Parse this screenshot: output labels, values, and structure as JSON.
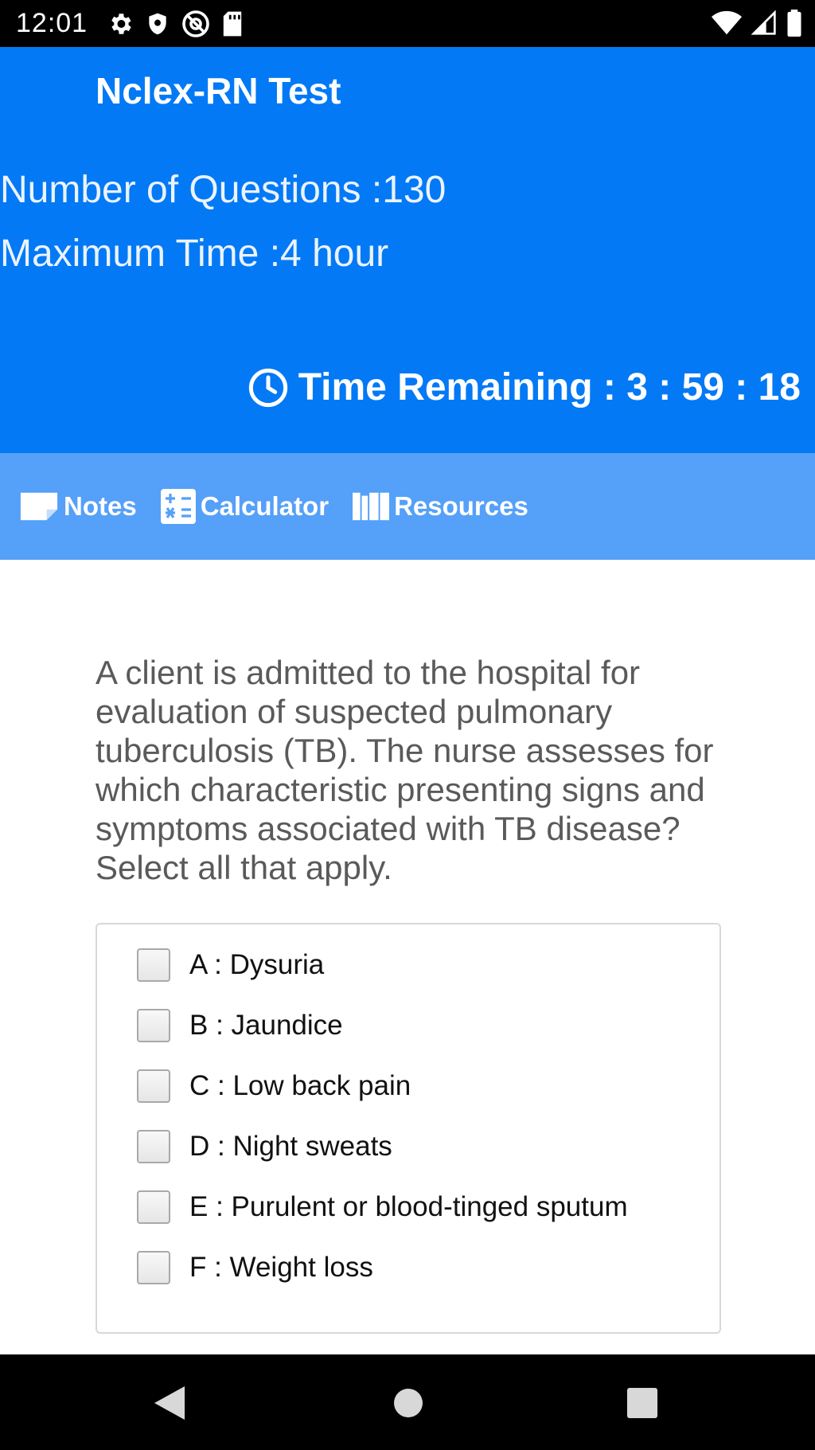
{
  "status_bar": {
    "time": "12:01",
    "left_icons": [
      "gear-icon",
      "shield-icon",
      "at-sign-icon",
      "sd-card-icon"
    ],
    "right_icons": [
      "wifi-icon",
      "cell-signal-icon",
      "battery-icon"
    ]
  },
  "header": {
    "title": "Nclex-RN Test",
    "number_of_questions": "Number of Questions :130",
    "maximum_time": "Maximum Time :4 hour",
    "time_remaining": "Time Remaining : 3 : 59 : 18",
    "background_color": "#0379f5"
  },
  "toolbar": {
    "background_color": "#55a0f8",
    "items": [
      {
        "label": "Notes",
        "icon": "note-icon"
      },
      {
        "label": "Calculator",
        "icon": "calculator-icon"
      },
      {
        "label": "Resources",
        "icon": "book-icon"
      }
    ]
  },
  "question": {
    "text": "A client is admitted to the hospital for evaluation of suspected pulmonary tuberculosis (TB). The nurse assesses for which characteristic presenting signs and symptoms associated with TB disease? Select all that apply.",
    "options": [
      {
        "label": "A : Dysuria",
        "checked": false
      },
      {
        "label": "B : Jaundice",
        "checked": false
      },
      {
        "label": "C : Low back pain",
        "checked": false
      },
      {
        "label": "D : Night sweats",
        "checked": false
      },
      {
        "label": "E : Purulent or blood-tinged sputum",
        "checked": false
      },
      {
        "label": "F : Weight loss",
        "checked": false
      }
    ]
  },
  "nav_bar": {
    "buttons": [
      "back-icon",
      "home-icon",
      "recents-icon"
    ]
  }
}
